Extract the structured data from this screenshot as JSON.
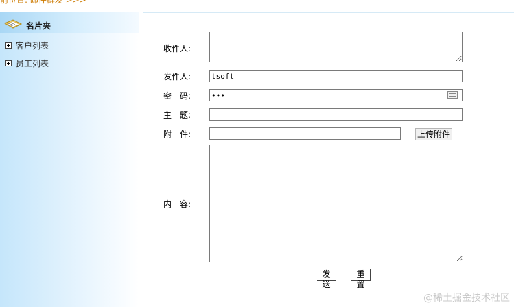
{
  "breadcrumb": {
    "text": "前位置: 邮件群发 >>>"
  },
  "sidebar": {
    "title": "名片夹",
    "items": [
      {
        "label": "客户列表"
      },
      {
        "label": "员工列表"
      }
    ]
  },
  "form": {
    "recipients": {
      "label": "收件人:",
      "value": ""
    },
    "sender": {
      "label": "发件人:",
      "value": "tsoft"
    },
    "password": {
      "label": "密　码:",
      "value": "•••"
    },
    "subject": {
      "label": "主　题:",
      "value": ""
    },
    "attachment": {
      "label": "附　件:",
      "value": "",
      "upload_label": "上传附件"
    },
    "content": {
      "label": "内　容:",
      "value": ""
    },
    "send_label": "发送",
    "reset_label": "重置"
  },
  "watermark": {
    "text": "@稀土掘金技术社区"
  },
  "colors": {
    "breadcrumb": "#cc7a00",
    "sidebar_gradient_start": "#c5e6fb",
    "border": "#7a7a7a"
  }
}
